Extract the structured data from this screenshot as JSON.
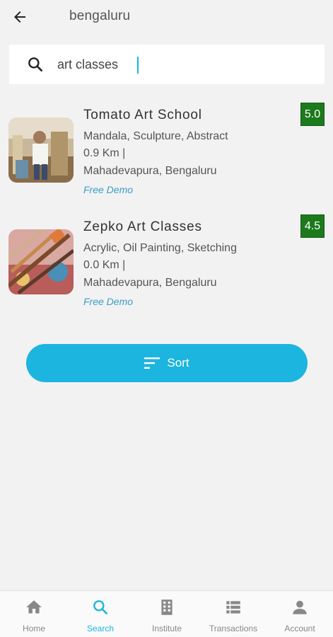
{
  "header": {
    "city": "bengaluru"
  },
  "search": {
    "value": "art classes"
  },
  "results": [
    {
      "name": "Tomato Art School",
      "categories": "Mandala, Sculpture, Abstract",
      "distance": "0.9 Km |",
      "location": "Mahadevapura, Bengaluru",
      "offer": "Free Demo",
      "rating": "5.0"
    },
    {
      "name": "Zepko Art Classes",
      "categories": "Acrylic, Oil Painting, Sketching",
      "distance": "0.0 Km |",
      "location": "Mahadevapura, Bengaluru",
      "offer": "Free Demo",
      "rating": "4.5"
    }
  ],
  "sort_button": {
    "label": "Sort"
  },
  "bottom_nav": [
    {
      "label": "Home",
      "icon": "home-icon"
    },
    {
      "label": "Search",
      "icon": "search-icon",
      "active": true
    },
    {
      "label": "Institute",
      "icon": "building-icon"
    },
    {
      "label": "Transactions",
      "icon": "list-icon"
    },
    {
      "label": "Account",
      "icon": "person-icon"
    }
  ],
  "colors": {
    "accent": "#1cb5df",
    "rating_bg": "#1c7a1c",
    "background": "#f2f2f2",
    "offer_text": "#3a9ec7"
  }
}
